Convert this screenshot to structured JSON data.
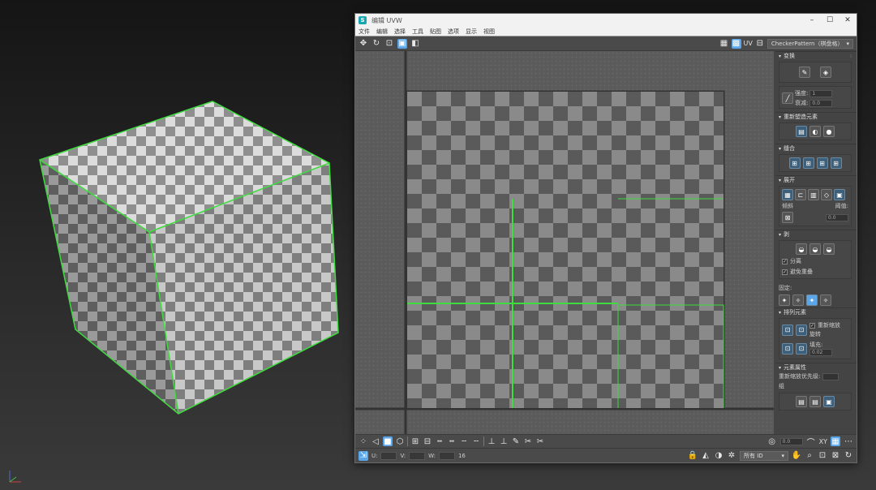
{
  "uv_editor": {
    "title": "编辑 UVW",
    "window_buttons": {
      "minimize": "–",
      "maximize": "☐",
      "close": "✕"
    },
    "menu": [
      "文件",
      "编辑",
      "选择",
      "工具",
      "贴图",
      "选项",
      "显示",
      "视图"
    ],
    "toolbar_top": {
      "uv_label": "UV",
      "map_dropdown": "CheckerPattern（棋盘格）"
    },
    "right_panel": {
      "rollouts": [
        {
          "label": "变换"
        },
        {
          "label": "重新塑造元素"
        },
        {
          "label": "缝合"
        },
        {
          "label": "展开"
        },
        {
          "label": "剥"
        },
        {
          "label": "排列元素"
        },
        {
          "label": "元素属性"
        }
      ],
      "transform": {
        "spinner1_label": "强度:",
        "spinner1_value": "1",
        "spinner2_label": "衰减:",
        "spinner2_value": "0.0"
      },
      "unfold": {
        "label": "倾斜",
        "spinner_label": "阈值:",
        "spinner_value": "0.0"
      },
      "peel": {
        "check1": "分离",
        "check2": "避免重叠",
        "pins_label": "固定:"
      },
      "arrange": {
        "check1": "重新缩放",
        "check2": "旋转",
        "padding_label": "填充:",
        "padding_value": "0.02"
      },
      "element_props": {
        "label": "重新缩放优先级:",
        "group_label": "组"
      }
    },
    "toolbar_bottom": {
      "value_field": "0.0",
      "xy_label": "XY",
      "coord_u_label": "U:",
      "coord_v_label": "V:",
      "coord_w_label": "W:",
      "coords_value": "16",
      "display_dropdown": "所有 ID"
    }
  },
  "colors": {
    "uv_edge": "#3fdc3f",
    "checker_light": "#8a8a8a",
    "checker_dark": "#5a5a5a",
    "accent": "#5aa6e8"
  }
}
